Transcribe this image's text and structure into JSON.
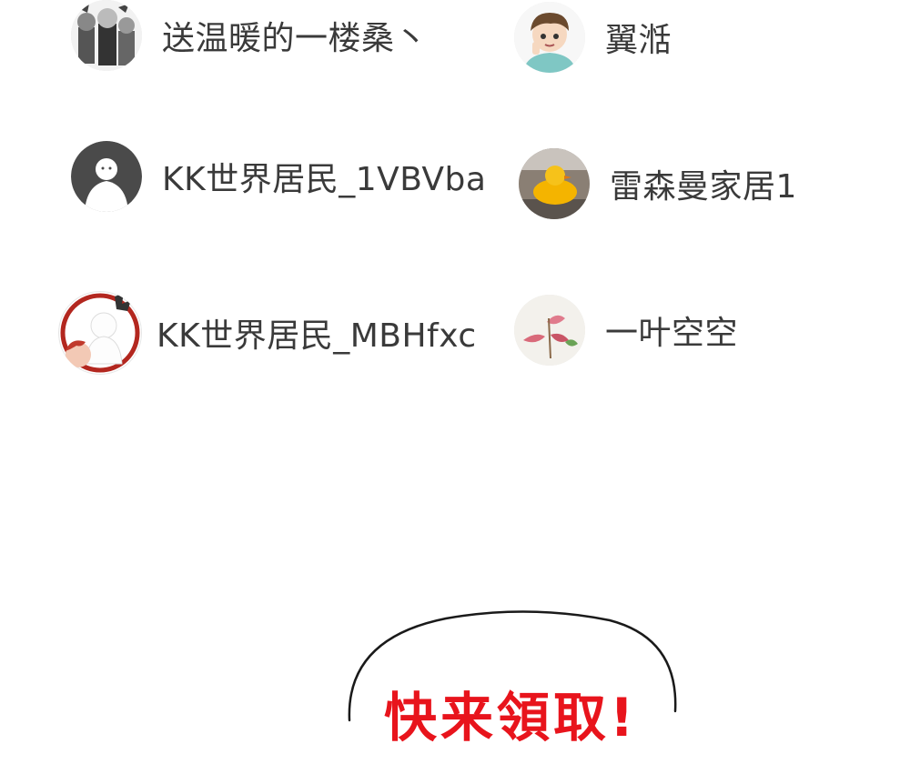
{
  "users": [
    {
      "name": "送温暖的一楼桑丶",
      "avatar": "manga-group-avatar"
    },
    {
      "name": "翼湉",
      "avatar": "anime-boy-avatar"
    },
    {
      "name": "KK世界居民_1VBVba",
      "avatar": "default-ghost-avatar"
    },
    {
      "name": "雷森曼家居1",
      "avatar": "yellow-duck-avatar"
    },
    {
      "name": "KK世界居民_MBHfxc",
      "avatar": "framed-ghost-avatar"
    },
    {
      "name": "一叶空空",
      "avatar": "flower-avatar"
    }
  ],
  "bubble": {
    "text": "快来領取!"
  },
  "colors": {
    "name_text": "#3a3a3a",
    "bubble_text": "#e8141c"
  }
}
